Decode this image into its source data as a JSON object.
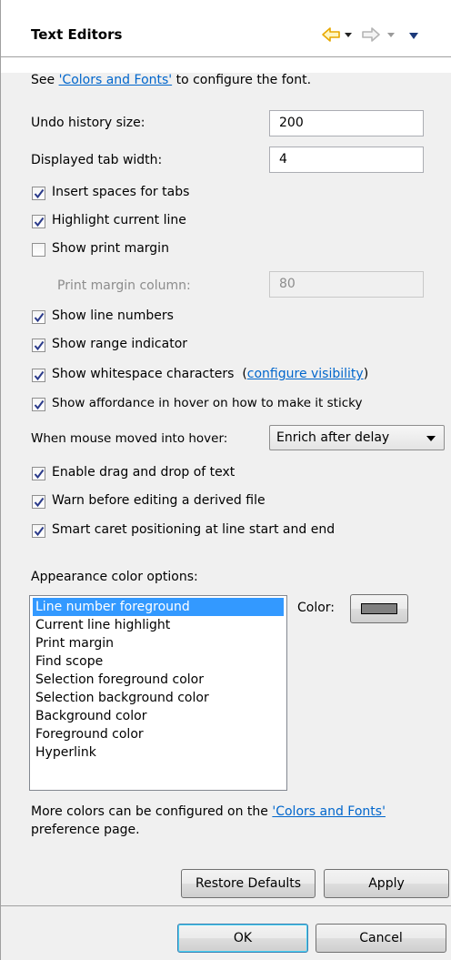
{
  "header": {
    "title": "Text Editors"
  },
  "intro": {
    "prefix": "See ",
    "link": "'Colors and Fonts'",
    "suffix": " to configure the font."
  },
  "fields": {
    "undo_label": "Undo history size:",
    "undo_value": "200",
    "tab_label": "Displayed tab width:",
    "tab_value": "4",
    "margin_label": "Print margin column:",
    "margin_value": "80"
  },
  "checkboxes": {
    "insert_spaces": {
      "label": "Insert spaces for tabs",
      "checked": true
    },
    "highlight_line": {
      "label": "Highlight current line",
      "checked": true
    },
    "print_margin": {
      "label": "Show print margin",
      "checked": false
    },
    "line_numbers": {
      "label": "Show line numbers",
      "checked": true
    },
    "range_indicator": {
      "label": "Show range indicator",
      "checked": true
    },
    "whitespace": {
      "label": "Show whitespace characters",
      "checked": true,
      "link_open": "(",
      "link": "configure visibility",
      "link_close": ")"
    },
    "affordance": {
      "label": "Show affordance in hover on how to make it sticky",
      "checked": true
    },
    "drag_drop": {
      "label": "Enable drag and drop of text",
      "checked": true
    },
    "warn_derived": {
      "label": "Warn before editing a derived file",
      "checked": true
    },
    "smart_caret": {
      "label": "Smart caret positioning at line start and end",
      "checked": true
    }
  },
  "hover": {
    "label": "When mouse moved into hover:",
    "value": "Enrich after delay"
  },
  "appearance": {
    "label": "Appearance color options:",
    "items": [
      "Line number foreground",
      "Current line highlight",
      "Print margin",
      "Find scope",
      "Selection foreground color",
      "Selection background color",
      "Background color",
      "Foreground color",
      "Hyperlink"
    ],
    "selected_index": 0,
    "color_label": "Color:",
    "swatch_color": "#808080"
  },
  "footer_note": {
    "prefix": "More colors can be configured on the ",
    "link": "'Colors and Fonts'",
    "line2": "preference page."
  },
  "buttons": {
    "restore": "Restore Defaults",
    "apply": "Apply",
    "ok": "OK",
    "cancel": "Cancel"
  },
  "colors": {
    "link": "#0066cc",
    "selection": "#3399ff",
    "nav_back": "#e8a800"
  }
}
